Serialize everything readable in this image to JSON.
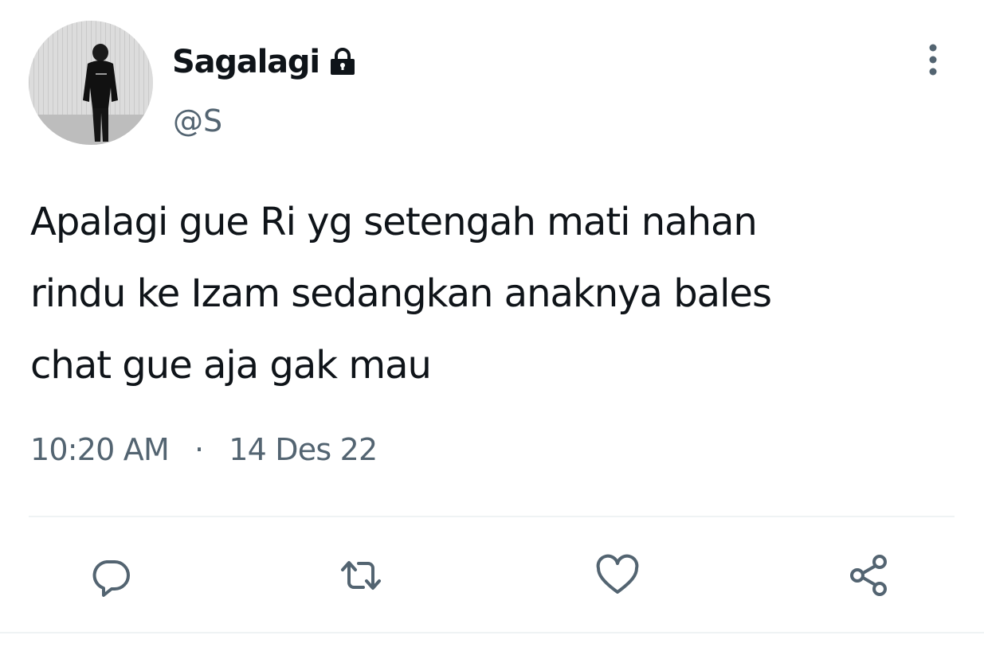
{
  "user": {
    "display_name": "Sagalagi",
    "handle": "@S",
    "protected": true
  },
  "tweet": {
    "text_lines": [
      "Apalagi gue Ri yg setengah mati nahan",
      "rindu ke Izam sedangkan anaknya bales",
      "chat gue aja gak mau"
    ],
    "time": "10:20 AM",
    "separator": "·",
    "date": "14 Des 22"
  },
  "actions": {
    "reply": "reply-icon",
    "retweet": "retweet-icon",
    "like": "heart-icon",
    "share": "share-icon"
  },
  "colors": {
    "text_primary": "#0f1419",
    "text_secondary": "#536471",
    "divider": "#eff3f4"
  }
}
